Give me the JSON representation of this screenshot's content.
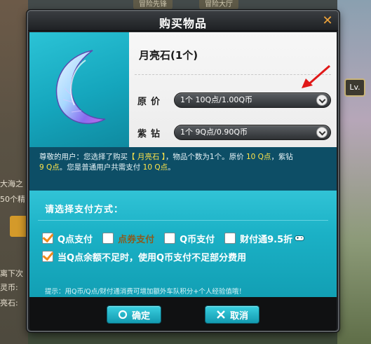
{
  "dialog": {
    "title": "购买物品",
    "close_glyph": "✕"
  },
  "item": {
    "name": "月亮石(1个)",
    "icon": "crescent-moon-gem",
    "price_label": "原价",
    "price_value": "1个  10Q点/1.00Q币",
    "purple_label": "紫钻",
    "purple_value": "1个  9Q点/0.90Q币"
  },
  "description": {
    "line1_a": "尊敬的用户：您选择了购买",
    "line1_item": "【 月亮石 】",
    "line1_b": "，物品个数为1个。原价 ",
    "line1_price": "10 Q点",
    "line1_c": "，紫钻",
    "line2_price": "9 Q点",
    "line2_a": "。您是普通用户共需支付 ",
    "line2_total": "10 Q点",
    "line2_b": "。"
  },
  "payment": {
    "title": "请选择支付方式：",
    "options": [
      {
        "label": "Q点支付",
        "checked": true
      },
      {
        "label": "点券支付",
        "checked": false
      },
      {
        "label": "Q币支付",
        "checked": false
      },
      {
        "label": "财付通9.5折",
        "checked": false
      }
    ],
    "fallback_label": "当Q点余额不足时，使用Q币支付不足部分费用",
    "fallback_checked": true,
    "tip": "提示：用Q币/Q点/财付通消费可增加额外车队积分+个人经验值哦！"
  },
  "buttons": {
    "confirm_label": "确定",
    "cancel_label": "取消"
  },
  "background": {
    "tab1": "冒险先锋",
    "tab2": "冒险大厅",
    "lv_badge": "Lv.",
    "side_text_1": "大海之",
    "side_text_2": "50个精",
    "side_text_3": "离下次",
    "side_text_4": "灵币:",
    "side_text_5": "亮石:"
  },
  "colors": {
    "accent_cyan": "#1bb1c6",
    "checkbox_orange": "#f08a1a",
    "highlight_yellow": "#ffe44a",
    "desc_bg": "#0d4e66"
  }
}
